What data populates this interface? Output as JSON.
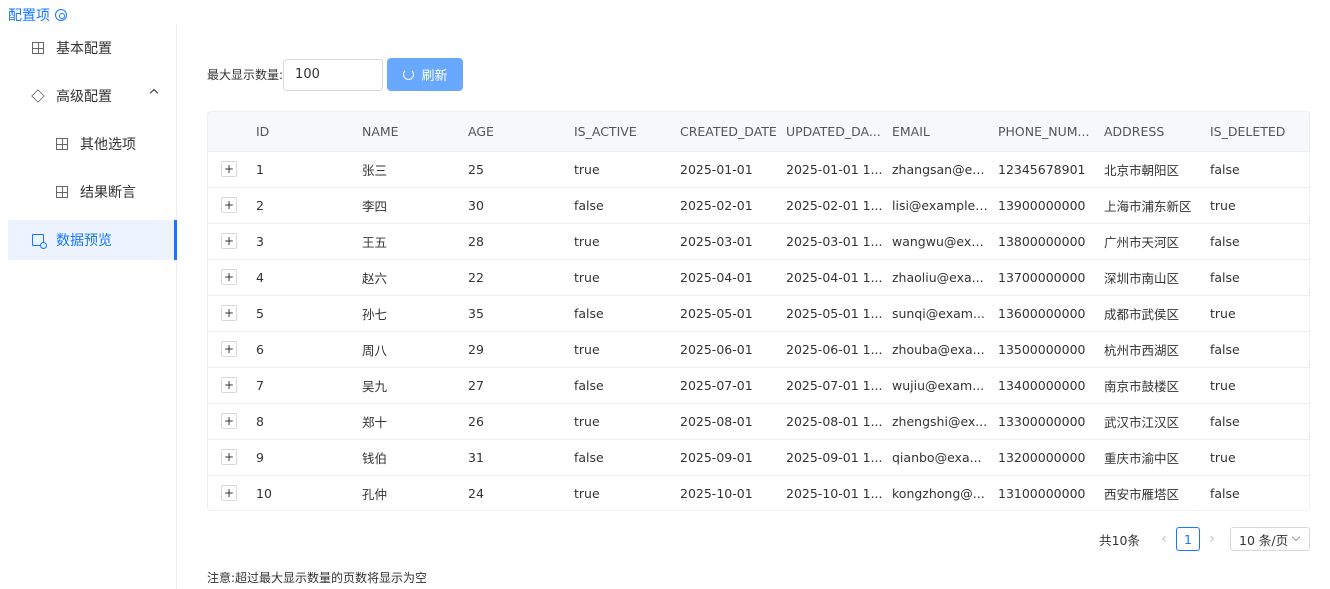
{
  "header": {
    "title": "配置项",
    "icon": "settings-circle-icon"
  },
  "sidebar": {
    "items": [
      {
        "label": "基本配置",
        "icon": "grid-icon"
      },
      {
        "label": "高级配置",
        "icon": "cube-icon",
        "expanded": true
      },
      {
        "label": "其他选项",
        "icon": "grid-icon"
      },
      {
        "label": "结果断言",
        "icon": "grid-icon"
      },
      {
        "label": "数据预览",
        "icon": "data-preview-icon",
        "active": true
      }
    ]
  },
  "toolbar": {
    "max_label": "最大显示数量:",
    "max_value": "100",
    "refresh_label": "刷新"
  },
  "table": {
    "columns": [
      "ID",
      "NAME",
      "AGE",
      "IS_ACTIVE",
      "CREATED_DATE",
      "UPDATED_DA...",
      "EMAIL",
      "PHONE_NUM...",
      "ADDRESS",
      "IS_DELETED"
    ],
    "rows": [
      [
        "1",
        "张三",
        "25",
        "true",
        "2025-01-01",
        "2025-01-01 1...",
        "zhangsan@ex...",
        "12345678901",
        "北京市朝阳区",
        "false"
      ],
      [
        "2",
        "李四",
        "30",
        "false",
        "2025-02-01",
        "2025-02-01 1...",
        "lisi@example....",
        "13900000000",
        "上海市浦东新区",
        "true"
      ],
      [
        "3",
        "王五",
        "28",
        "true",
        "2025-03-01",
        "2025-03-01 1...",
        "wangwu@exa...",
        "13800000000",
        "广州市天河区",
        "false"
      ],
      [
        "4",
        "赵六",
        "22",
        "true",
        "2025-04-01",
        "2025-04-01 1...",
        "zhaoliu@exa...",
        "13700000000",
        "深圳市南山区",
        "false"
      ],
      [
        "5",
        "孙七",
        "35",
        "false",
        "2025-05-01",
        "2025-05-01 1...",
        "sunqi@exam...",
        "13600000000",
        "成都市武侯区",
        "true"
      ],
      [
        "6",
        "周八",
        "29",
        "true",
        "2025-06-01",
        "2025-06-01 1...",
        "zhouba@exa...",
        "13500000000",
        "杭州市西湖区",
        "false"
      ],
      [
        "7",
        "吴九",
        "27",
        "false",
        "2025-07-01",
        "2025-07-01 1...",
        "wujiu@exam...",
        "13400000000",
        "南京市鼓楼区",
        "true"
      ],
      [
        "8",
        "郑十",
        "26",
        "true",
        "2025-08-01",
        "2025-08-01 1...",
        "zhengshi@ex...",
        "13300000000",
        "武汉市江汉区",
        "false"
      ],
      [
        "9",
        "钱伯",
        "31",
        "false",
        "2025-09-01",
        "2025-09-01 1...",
        "qianbo@exa...",
        "13200000000",
        "重庆市渝中区",
        "true"
      ],
      [
        "10",
        "孔仲",
        "24",
        "true",
        "2025-10-01",
        "2025-10-01 1...",
        "kongzhong@...",
        "13100000000",
        "西安市雁塔区",
        "false"
      ]
    ],
    "expand_symbol": "+"
  },
  "pagination": {
    "total": "共10条",
    "current_page": "1",
    "page_size": "10 条/页",
    "prev": "‹",
    "next": "›"
  },
  "note": "注意:超过最大显示数量的页数将显示为空",
  "colors": {
    "accent": "#1677ff",
    "button": "#69a8ff",
    "active_bg": "#edf4ff"
  }
}
